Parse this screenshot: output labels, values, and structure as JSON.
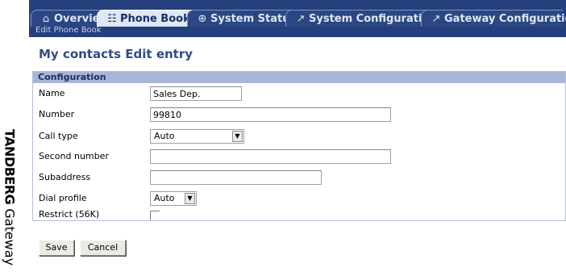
{
  "brand": {
    "strong": "TANDBERG",
    "light": "Gateway"
  },
  "tabs": [
    {
      "label": "Overview",
      "icon": "⌂",
      "icon_name": "home-icon"
    },
    {
      "label": "Phone Book",
      "icon": "☷",
      "icon_name": "phonebook-icon"
    },
    {
      "label": "System Status",
      "icon": "⊕",
      "icon_name": "status-icon"
    },
    {
      "label": "System Configuration",
      "icon": "↗",
      "icon_name": "wrench-icon"
    },
    {
      "label": "Gateway Configuration",
      "icon": "↗",
      "icon_name": "wrench-icon"
    }
  ],
  "breadcrumb": "Edit Phone Book",
  "page_title": "My contacts Edit entry",
  "panel_title": "Configuration",
  "form": {
    "name_label": "Name",
    "name_value": "Sales Dep.",
    "number_label": "Number",
    "number_value": "99810",
    "calltype_label": "Call type",
    "calltype_value": "Auto",
    "second_label": "Second number",
    "second_value": "",
    "subaddress_label": "Subaddress",
    "subaddress_value": "",
    "dialprofile_label": "Dial profile",
    "dialprofile_value": "Auto",
    "restrict_label": "Restrict (56K)",
    "restrict_checked": false
  },
  "buttons": {
    "save": "Save",
    "cancel": "Cancel"
  },
  "colors": {
    "tabbar": "#253e7c",
    "panel_header": "#a9b5d8",
    "title": "#324a86"
  }
}
